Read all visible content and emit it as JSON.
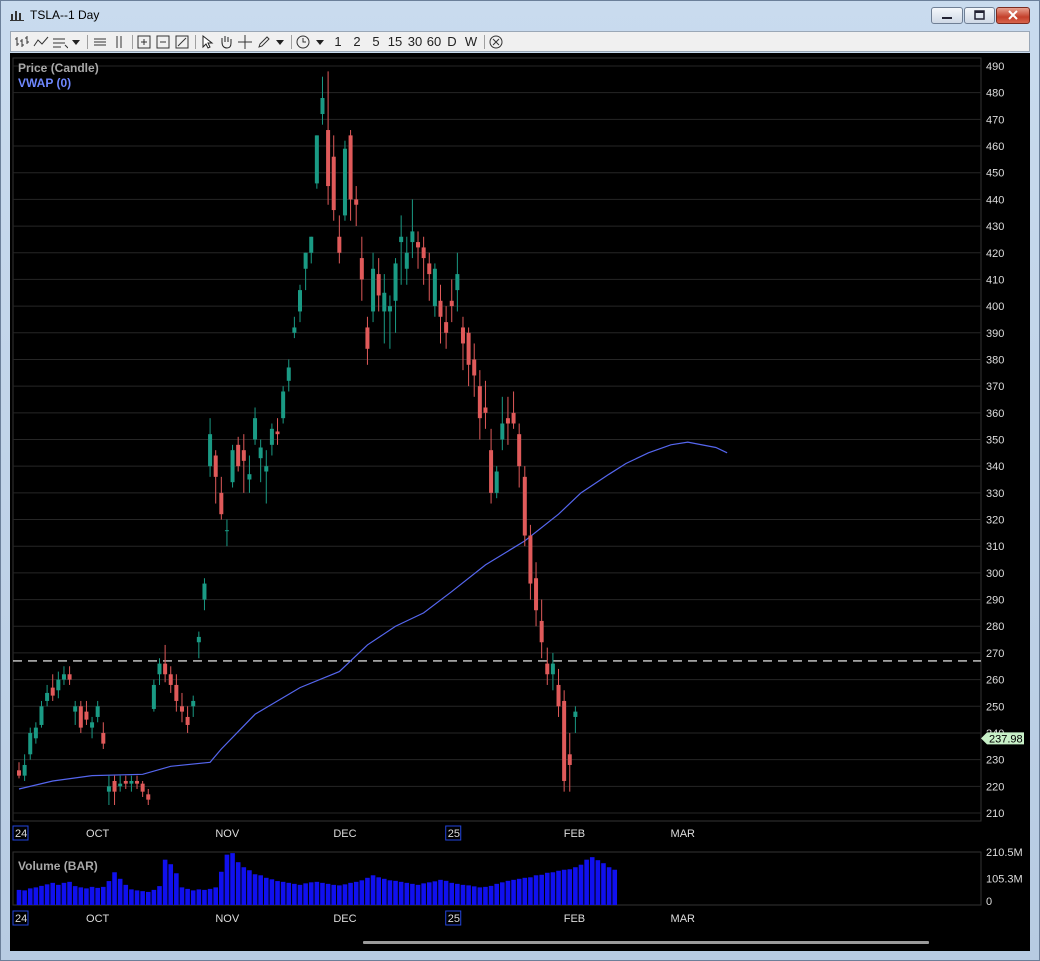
{
  "window": {
    "title": "TSLA--1 Day"
  },
  "toolbar": {
    "periods": [
      "1",
      "2",
      "5",
      "15",
      "30",
      "60",
      "D",
      "W"
    ]
  },
  "price_panel": {
    "title": "Price (Candle)",
    "indicator": "VWAP (0)",
    "last_price_label": "237.98",
    "y_ticks": [
      490,
      480,
      470,
      460,
      450,
      440,
      430,
      420,
      410,
      400,
      390,
      380,
      370,
      360,
      350,
      340,
      330,
      320,
      310,
      300,
      290,
      280,
      270,
      260,
      250,
      240,
      230,
      220,
      210
    ]
  },
  "volume_panel": {
    "title": "Volume (BAR)",
    "y_ticks": [
      "210.5M",
      "105.3M",
      "0"
    ]
  },
  "x_labels": [
    {
      "text": "24",
      "boxed": true,
      "idx": 0
    },
    {
      "text": "OCT",
      "boxed": false,
      "idx": 13
    },
    {
      "text": "NOV",
      "boxed": false,
      "idx": 36
    },
    {
      "text": "DEC",
      "boxed": false,
      "idx": 57
    },
    {
      "text": "25",
      "boxed": true,
      "idx": 77
    },
    {
      "text": "FEB",
      "boxed": false,
      "idx": 98
    },
    {
      "text": "MAR",
      "boxed": false,
      "idx": 117
    }
  ],
  "colors": {
    "up": "#1a9a84",
    "down": "#e05a5a",
    "vwap": "#5566ee",
    "volume": "#1010ee",
    "grid": "#262626",
    "axis_text": "#dddddd",
    "dashed": "#ffffff",
    "last_bg": "#c8f0c8"
  },
  "chart_data": {
    "type": "candlestick",
    "price_ylim": [
      207,
      493
    ],
    "reference_line": 267,
    "candles": [
      [
        226,
        229,
        223,
        224
      ],
      [
        224,
        232,
        222,
        228
      ],
      [
        232,
        242,
        230,
        240
      ],
      [
        238,
        244,
        236,
        242
      ],
      [
        243,
        252,
        242,
        250
      ],
      [
        252,
        258,
        250,
        255
      ],
      [
        257,
        262,
        252,
        254
      ],
      [
        256,
        263,
        253,
        260
      ],
      [
        260,
        265,
        258,
        262
      ],
      [
        262,
        265,
        258,
        260
      ],
      [
        248,
        252,
        243,
        250
      ],
      [
        250,
        252,
        240,
        242
      ],
      [
        248,
        252,
        243,
        245
      ],
      [
        242,
        246,
        238,
        244
      ],
      [
        246,
        252,
        244,
        250
      ],
      [
        240,
        244,
        234,
        236
      ],
      [
        218,
        224,
        213,
        220
      ],
      [
        222,
        224,
        213,
        218
      ],
      [
        220,
        224,
        218,
        221
      ],
      [
        222,
        224,
        219,
        221
      ],
      [
        221,
        224,
        218,
        222
      ],
      [
        222,
        224,
        219,
        221
      ],
      [
        221,
        222,
        216,
        218
      ],
      [
        217,
        219,
        213,
        215
      ],
      [
        249,
        260,
        248,
        258
      ],
      [
        262,
        268,
        258,
        266
      ],
      [
        266,
        273,
        259,
        262
      ],
      [
        262,
        265,
        255,
        258
      ],
      [
        258,
        262,
        248,
        252
      ],
      [
        250,
        255,
        244,
        248
      ],
      [
        246,
        250,
        240,
        243
      ],
      [
        250,
        254,
        246,
        252
      ],
      [
        274,
        278,
        268,
        276
      ],
      [
        290,
        298,
        286,
        296
      ],
      [
        340,
        358,
        336,
        352
      ],
      [
        344,
        346,
        326,
        336
      ],
      [
        330,
        336,
        320,
        322
      ],
      [
        316,
        320,
        310,
        316
      ],
      [
        334,
        348,
        332,
        346
      ],
      [
        348,
        351,
        338,
        340
      ],
      [
        346,
        352,
        330,
        342
      ],
      [
        335,
        344,
        330,
        337
      ],
      [
        350,
        362,
        348,
        358
      ],
      [
        343,
        350,
        334,
        347
      ],
      [
        338,
        346,
        326,
        340
      ],
      [
        348,
        356,
        344,
        354
      ],
      [
        353,
        358,
        348,
        352
      ],
      [
        358,
        370,
        356,
        368
      ],
      [
        372,
        380,
        368,
        377
      ],
      [
        390,
        396,
        388,
        392
      ],
      [
        398,
        408,
        394,
        406
      ],
      [
        414,
        420,
        406,
        420
      ],
      [
        420,
        426,
        416,
        426
      ],
      [
        446,
        464,
        444,
        464
      ],
      [
        472,
        486,
        468,
        478
      ],
      [
        466,
        488,
        438,
        445
      ],
      [
        456,
        464,
        432,
        436
      ],
      [
        426,
        434,
        416,
        420
      ],
      [
        434,
        462,
        432,
        459
      ],
      [
        464,
        466,
        432,
        440
      ],
      [
        440,
        445,
        430,
        438
      ],
      [
        418,
        426,
        402,
        410
      ],
      [
        392,
        396,
        378,
        384
      ],
      [
        398,
        420,
        394,
        414
      ],
      [
        412,
        418,
        398,
        404
      ],
      [
        398,
        412,
        386,
        405
      ],
      [
        398,
        404,
        384,
        400
      ],
      [
        402,
        418,
        390,
        416
      ],
      [
        424,
        434,
        408,
        426
      ],
      [
        414,
        426,
        408,
        420
      ],
      [
        424,
        440,
        418,
        428
      ],
      [
        424,
        428,
        414,
        422
      ],
      [
        422,
        426,
        408,
        418
      ],
      [
        416,
        420,
        402,
        412
      ],
      [
        400,
        416,
        396,
        414
      ],
      [
        402,
        408,
        386,
        396
      ],
      [
        394,
        400,
        384,
        390
      ],
      [
        402,
        410,
        394,
        400
      ],
      [
        406,
        420,
        398,
        412
      ],
      [
        392,
        396,
        376,
        386
      ],
      [
        390,
        392,
        370,
        378
      ],
      [
        380,
        386,
        366,
        374
      ],
      [
        370,
        376,
        350,
        358
      ],
      [
        362,
        372,
        354,
        360
      ],
      [
        346,
        354,
        326,
        330
      ],
      [
        330,
        340,
        328,
        338
      ],
      [
        350,
        366,
        346,
        356
      ],
      [
        358,
        366,
        348,
        356
      ],
      [
        360,
        368,
        354,
        356
      ],
      [
        352,
        356,
        332,
        340
      ],
      [
        336,
        340,
        310,
        314
      ],
      [
        314,
        318,
        290,
        296
      ],
      [
        298,
        304,
        280,
        286
      ],
      [
        282,
        290,
        268,
        274
      ],
      [
        266,
        272,
        258,
        262
      ],
      [
        262,
        270,
        256,
        266
      ],
      [
        258,
        264,
        246,
        250
      ],
      [
        252,
        256,
        218,
        222
      ],
      [
        232,
        240,
        218,
        228
      ],
      [
        246,
        250,
        240,
        248
      ]
    ],
    "volume_ylim": [
      0,
      210.5
    ],
    "volume": [
      60,
      58,
      66,
      70,
      76,
      82,
      88,
      80,
      88,
      92,
      75,
      70,
      66,
      72,
      68,
      72,
      95,
      130,
      104,
      80,
      62,
      58,
      55,
      52,
      60,
      75,
      180,
      162,
      126,
      70,
      64,
      58,
      62,
      60,
      64,
      70,
      132,
      200,
      206,
      170,
      150,
      138,
      122,
      118,
      108,
      102,
      95,
      92,
      88,
      84,
      80,
      86,
      90,
      92,
      88,
      84,
      80,
      78,
      82,
      88,
      92,
      98,
      108,
      118,
      110,
      104,
      98,
      96,
      92,
      88,
      84,
      80,
      86,
      90,
      94,
      100,
      96,
      88,
      84,
      80,
      78,
      74,
      70,
      72,
      76,
      84,
      90,
      96,
      100,
      104,
      108,
      110,
      118,
      120,
      128,
      130,
      136,
      140,
      142,
      150,
      160,
      180,
      190,
      178,
      166,
      150,
      140
    ],
    "vwap": [
      [
        0,
        219
      ],
      [
        6,
        222
      ],
      [
        13,
        224
      ],
      [
        22,
        224.5
      ],
      [
        27,
        227.5
      ],
      [
        34,
        229
      ],
      [
        36,
        234
      ],
      [
        42,
        247
      ],
      [
        50,
        257
      ],
      [
        57,
        263
      ],
      [
        62,
        273
      ],
      [
        67,
        280
      ],
      [
        72,
        285
      ],
      [
        77,
        293
      ],
      [
        83,
        303
      ],
      [
        90,
        312
      ],
      [
        96,
        322
      ],
      [
        100,
        330
      ],
      [
        105,
        337
      ],
      [
        108,
        341
      ],
      [
        112,
        345
      ],
      [
        116,
        348
      ],
      [
        119,
        349
      ],
      [
        124,
        347
      ],
      [
        126,
        345
      ]
    ]
  }
}
